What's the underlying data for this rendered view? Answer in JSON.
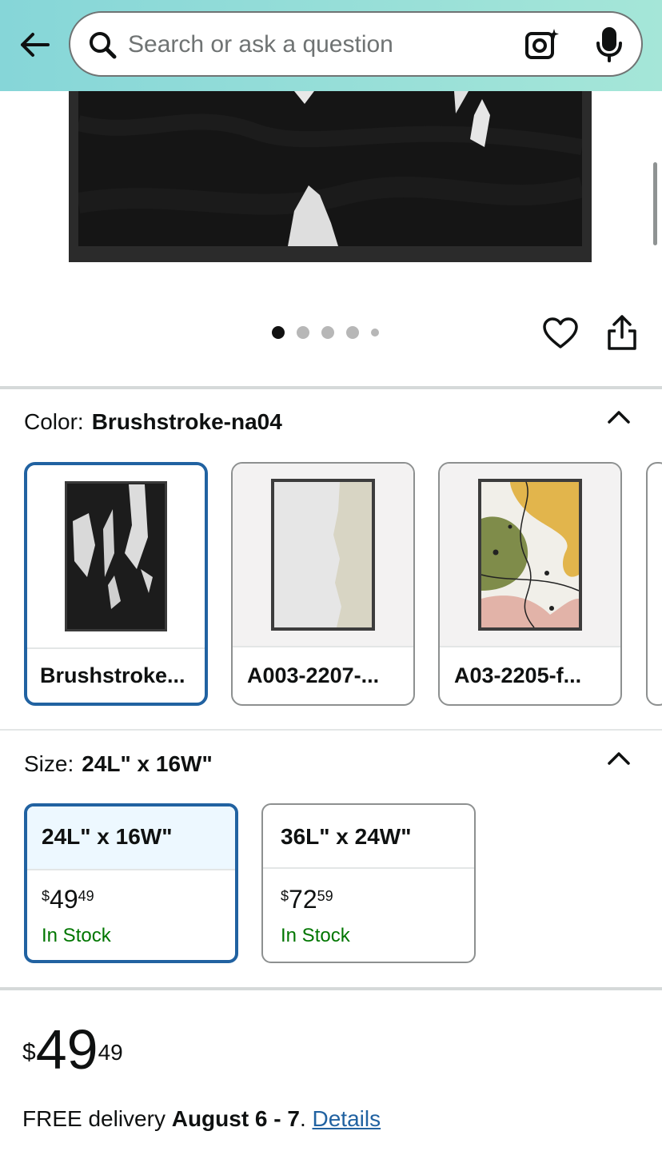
{
  "search": {
    "placeholder": "Search or ask a question"
  },
  "gallery": {
    "dot_count": 5,
    "active_index": 0
  },
  "color": {
    "label": "Color:",
    "selected": "Brushstroke-na04",
    "options": [
      {
        "label": "Brushstroke..."
      },
      {
        "label": "A003-2207-..."
      },
      {
        "label": "A03-2205-f..."
      }
    ]
  },
  "size": {
    "label": "Size:",
    "selected": "24L\" x 16W\"",
    "options": [
      {
        "label": "24L\" x 16W\"",
        "currency": "$",
        "whole": "49",
        "fraction": "49",
        "stock": "In Stock"
      },
      {
        "label": "36L\" x 24W\"",
        "currency": "$",
        "whole": "72",
        "fraction": "59",
        "stock": "In Stock"
      }
    ]
  },
  "price": {
    "currency": "$",
    "whole": "49",
    "fraction": "49"
  },
  "delivery": {
    "prefix": "FREE delivery",
    "dates": "August 6 - 7",
    "suffix": ". ",
    "link": "Details"
  },
  "colors": {
    "accent": "#2162a1",
    "in_stock": "#007600",
    "header_start": "#86d6d8",
    "header_end": "#a5e6d8"
  }
}
